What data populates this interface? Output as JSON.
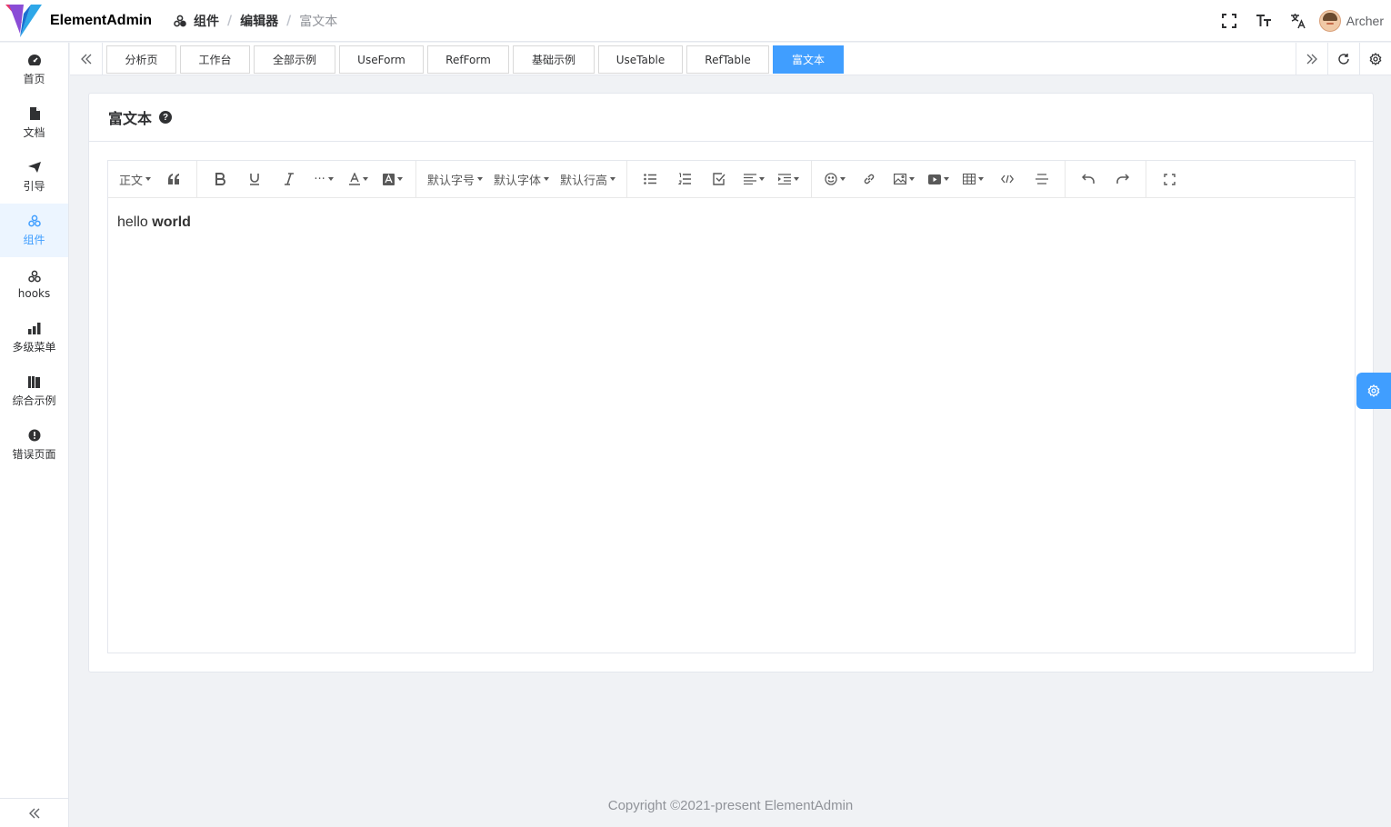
{
  "app": {
    "title": "ElementAdmin"
  },
  "breadcrumb": [
    "组件",
    "编辑器",
    "富文本"
  ],
  "header": {
    "user_name": "Archer"
  },
  "sidebar": {
    "items": [
      {
        "label": "首页",
        "icon": "dashboard-icon"
      },
      {
        "label": "文档",
        "icon": "document-icon"
      },
      {
        "label": "引导",
        "icon": "paper-plane-icon"
      },
      {
        "label": "组件",
        "icon": "components-icon",
        "active": true
      },
      {
        "label": "hooks",
        "icon": "hooks-icon"
      },
      {
        "label": "多级菜单",
        "icon": "bar-chart-icon"
      },
      {
        "label": "综合示例",
        "icon": "books-icon"
      },
      {
        "label": "错误页面",
        "icon": "error-icon"
      }
    ]
  },
  "tags": [
    {
      "label": "分析页"
    },
    {
      "label": "工作台"
    },
    {
      "label": "全部示例"
    },
    {
      "label": "UseForm"
    },
    {
      "label": "RefForm"
    },
    {
      "label": "基础示例"
    },
    {
      "label": "UseTable"
    },
    {
      "label": "RefTable"
    },
    {
      "label": "富文本",
      "active": true
    }
  ],
  "card": {
    "title": "富文本"
  },
  "editor": {
    "toolbar": {
      "header_select": "正文",
      "font_size_select": "默认字号",
      "font_family_select": "默认字体",
      "line_height_select": "默认行高",
      "more_label": "···"
    },
    "content": {
      "normal": "hello ",
      "bold": "world"
    }
  },
  "footer": {
    "copyright": "Copyright ©2021-present ElementAdmin"
  },
  "colors": {
    "primary": "#409eff",
    "active_bg": "#ecf5ff",
    "page_bg": "#f0f2f5"
  }
}
